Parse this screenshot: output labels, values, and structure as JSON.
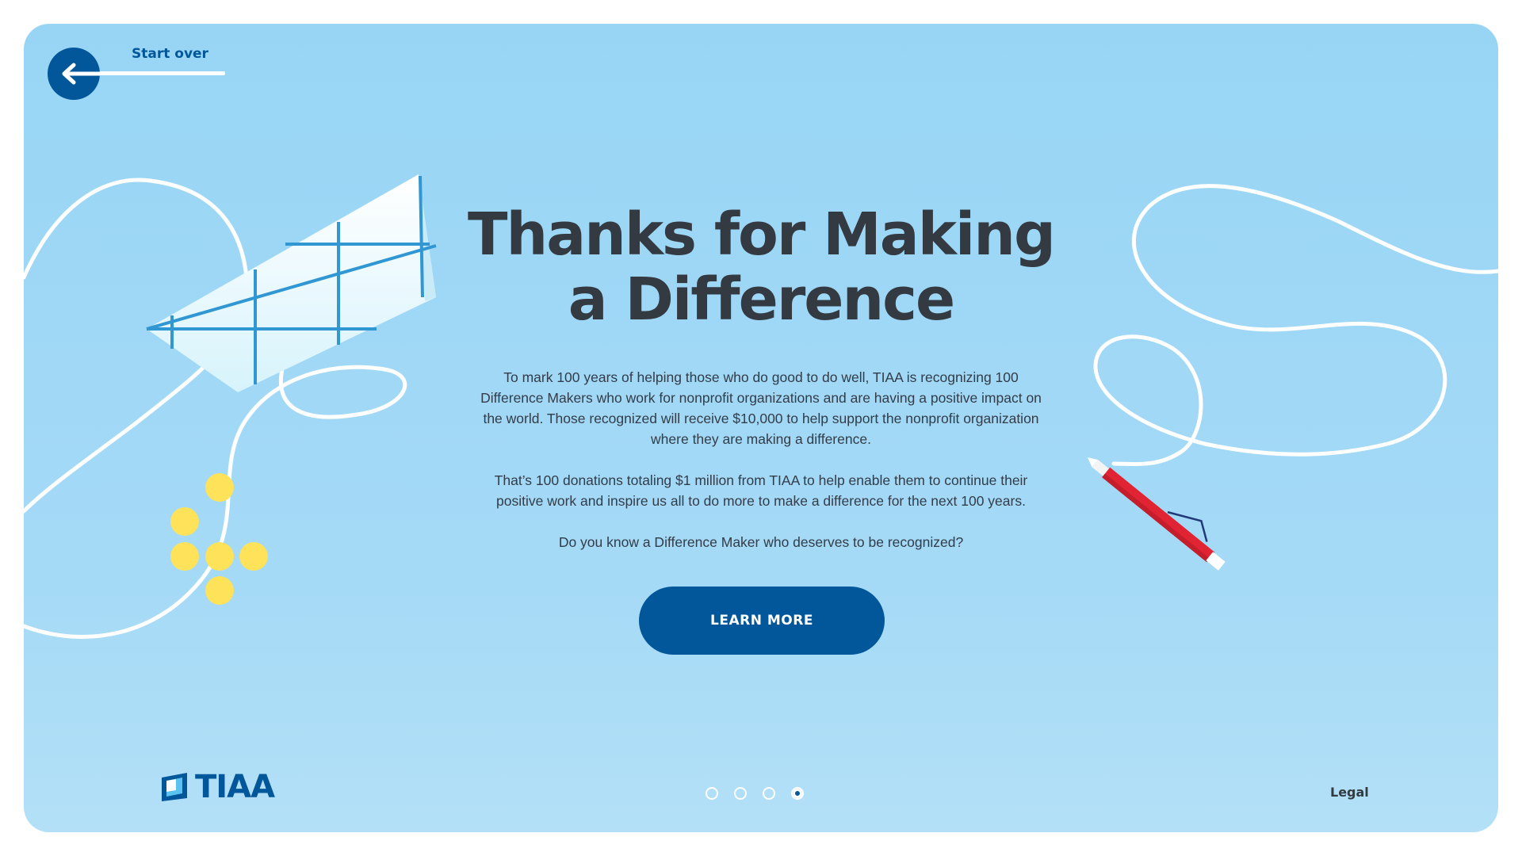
{
  "nav": {
    "start_over_label": "Start over"
  },
  "main": {
    "title_line1": "Thanks for Making",
    "title_line2": "a Difference",
    "paragraphs": [
      "To mark 100 years of helping those who do good to do well, TIAA is recognizing 100 Difference Makers who work for nonprofit organizations and are having a positive impact on the world. Those recognized will receive $10,000 to help support the nonprofit organization where they are making a difference.",
      "That’s 100 donations totaling $1 million from TIAA to help enable them to continue their positive work and inspire us all to do more to make a difference for the next 100 years.",
      "Do you know a Difference Maker who deserves to be recognized?"
    ],
    "cta_label": "LEARN MORE"
  },
  "footer": {
    "logo_text": "TIAA",
    "legal_label": "Legal",
    "pager": {
      "total": 4,
      "active_index": 3
    }
  },
  "colors": {
    "background": "#98d5f5",
    "brand_blue": "#02579a",
    "heading": "#343a42",
    "accent_yellow": "#fde25a",
    "accent_red": "#e02433"
  },
  "icons": {
    "back": "arrow-left-icon",
    "logo": "tiaa-logo-icon",
    "decor": [
      "paper-airplane-icon",
      "pen-icon",
      "flower-dots-icon"
    ]
  }
}
